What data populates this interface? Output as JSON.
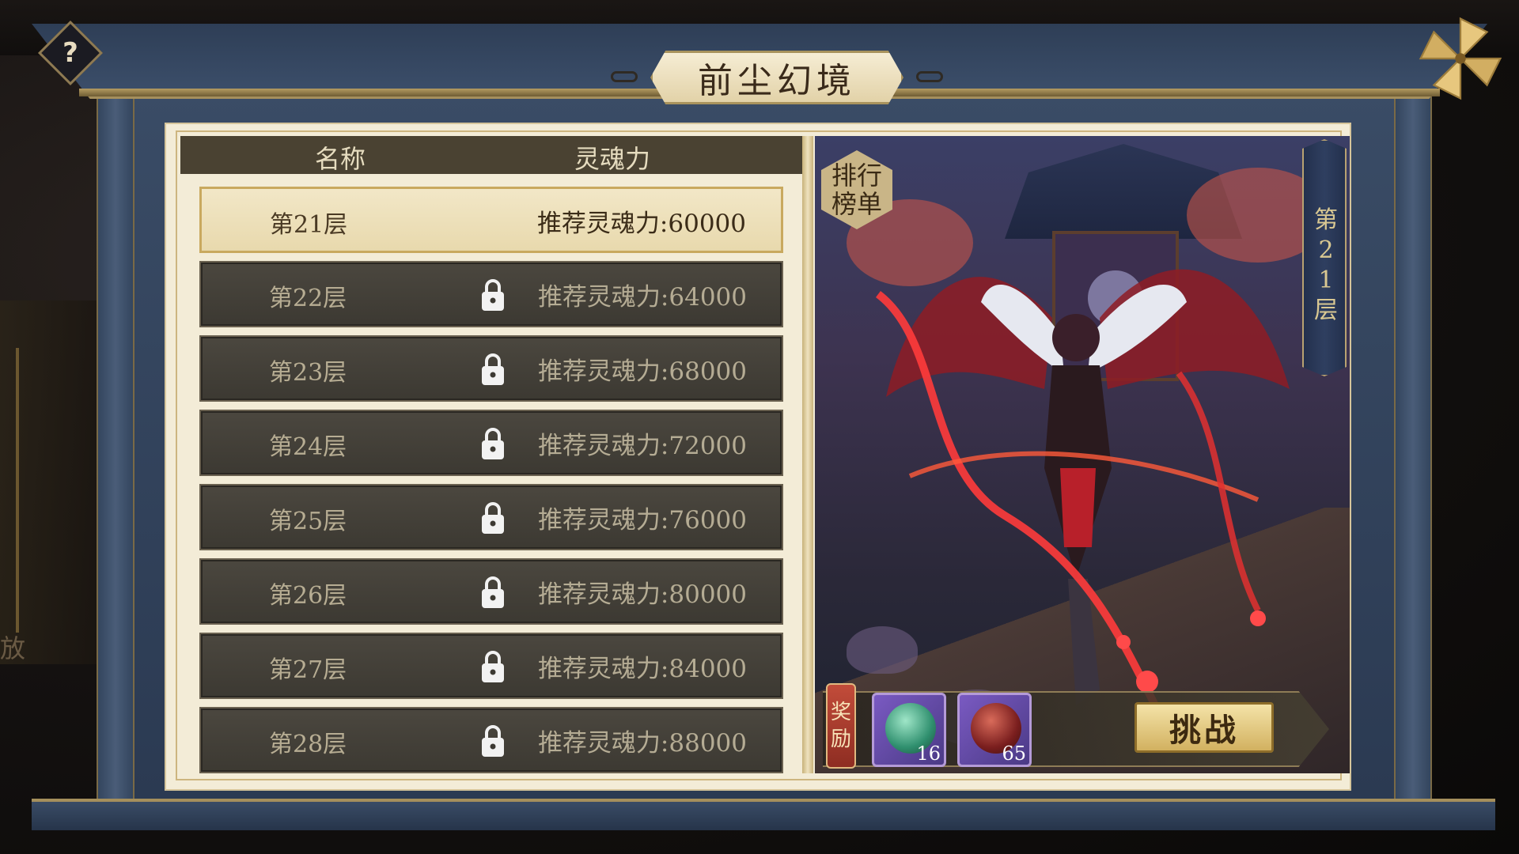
{
  "title": "前尘幻境",
  "help_symbol": "?",
  "background": {
    "left_text": "放"
  },
  "list": {
    "header": {
      "name": "名称",
      "power": "灵魂力"
    },
    "rows": [
      {
        "name": "第21层",
        "power": "推荐灵魂力:60000",
        "locked": false,
        "selected": true
      },
      {
        "name": "第22层",
        "power": "推荐灵魂力:64000",
        "locked": true,
        "selected": false
      },
      {
        "name": "第23层",
        "power": "推荐灵魂力:68000",
        "locked": true,
        "selected": false
      },
      {
        "name": "第24层",
        "power": "推荐灵魂力:72000",
        "locked": true,
        "selected": false
      },
      {
        "name": "第25层",
        "power": "推荐灵魂力:76000",
        "locked": true,
        "selected": false
      },
      {
        "name": "第26层",
        "power": "推荐灵魂力:80000",
        "locked": true,
        "selected": false
      },
      {
        "name": "第27层",
        "power": "推荐灵魂力:84000",
        "locked": true,
        "selected": false
      },
      {
        "name": "第28层",
        "power": "推荐灵魂力:88000",
        "locked": true,
        "selected": false
      }
    ]
  },
  "preview": {
    "rank_badge": "排行榜单",
    "floor_banner": "第21层"
  },
  "reward": {
    "label": "奖励",
    "items": [
      {
        "icon": "jade-dragon-orb-icon",
        "count": "16"
      },
      {
        "icon": "red-dragon-orb-icon",
        "count": "65"
      }
    ]
  },
  "challenge_button": "挑战",
  "icons": {
    "lock": "lock-icon",
    "close": "pinwheel-close-icon",
    "help": "help-icon"
  }
}
